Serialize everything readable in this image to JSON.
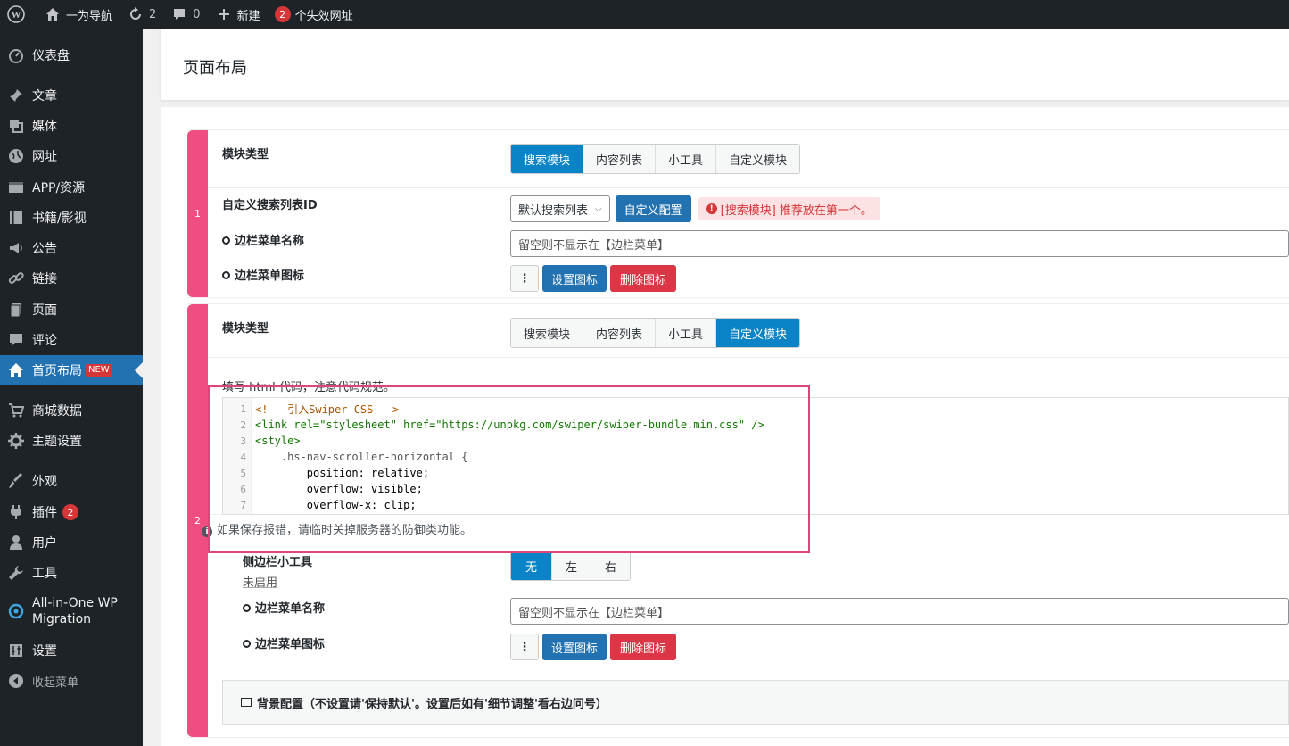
{
  "adminbar": {
    "site_name": "一为导航",
    "updates_count": "2",
    "comments_count": "0",
    "new_label": "新建",
    "broken_count": "2",
    "broken_label": "个失效网址"
  },
  "sidebar": {
    "items": [
      {
        "label": "仪表盘"
      },
      {
        "label": "文章"
      },
      {
        "label": "媒体"
      },
      {
        "label": "网址"
      },
      {
        "label": "APP/资源"
      },
      {
        "label": "书籍/影视"
      },
      {
        "label": "公告"
      },
      {
        "label": "链接"
      },
      {
        "label": "页面"
      },
      {
        "label": "评论"
      },
      {
        "label": "首页布局",
        "badge": "NEW"
      },
      {
        "label": "商城数据"
      },
      {
        "label": "主题设置"
      },
      {
        "label": "外观"
      },
      {
        "label": "插件",
        "count": "2"
      },
      {
        "label": "用户"
      },
      {
        "label": "工具"
      },
      {
        "label": "All-in-One WP",
        "label2": "Migration"
      },
      {
        "label": "设置"
      },
      {
        "label": "收起菜单"
      }
    ]
  },
  "page": {
    "title": "页面布局"
  },
  "groups": [
    {
      "index": "1",
      "module_type_label": "模块类型",
      "tabs": [
        "搜索模块",
        "内容列表",
        "小工具",
        "自定义模块"
      ],
      "search_list_label": "自定义搜索列表ID",
      "search_list_select": "默认搜索列表",
      "custom_config_btn": "自定义配置",
      "alert_text": "[搜索模块] 推荐放在第一个。",
      "menu_name_label": "边栏菜单名称",
      "menu_name_placeholder": "留空则不显示在【边栏菜单】",
      "menu_icon_label": "边栏菜单图标",
      "set_icon_btn": "设置图标",
      "delete_icon_btn": "删除图标"
    },
    {
      "index": "2",
      "module_type_label": "模块类型",
      "tabs": [
        "搜索模块",
        "内容列表",
        "小工具",
        "自定义模块"
      ],
      "code_note": "填写 html 代码，注意代码规范。",
      "code_lines": [
        "<!-- 引入Swiper CSS -->",
        "<link rel=\"stylesheet\" href=\"https://unpkg.com/swiper/swiper-bundle.min.css\" />",
        "<style>",
        "    .hs-nav-scroller-horizontal {",
        "        position: relative;",
        "        overflow: visible;",
        "        overflow-x: clip;"
      ],
      "hint": "如果保存报错，请临时关掉服务器的防御类功能。",
      "sidebar_widget_label": "侧边栏小工具",
      "sidebar_widget_sub": "未启用",
      "sidebar_widget_options": [
        "无",
        "左",
        "右"
      ],
      "menu_name_label": "边栏菜单名称",
      "menu_name_placeholder": "留空则不显示在【边栏菜单】",
      "menu_icon_label": "边栏菜单图标",
      "set_icon_btn": "设置图标",
      "delete_icon_btn": "删除图标",
      "bg_panel": "背景配置（不设置请'保持默认'。设置后如有'细节调整'看右边问号）"
    }
  ],
  "colors": {
    "accent": "#2271b1",
    "active_tab": "#0a84c6",
    "group_stripe": "#f04e80",
    "danger": "#dc3545"
  }
}
